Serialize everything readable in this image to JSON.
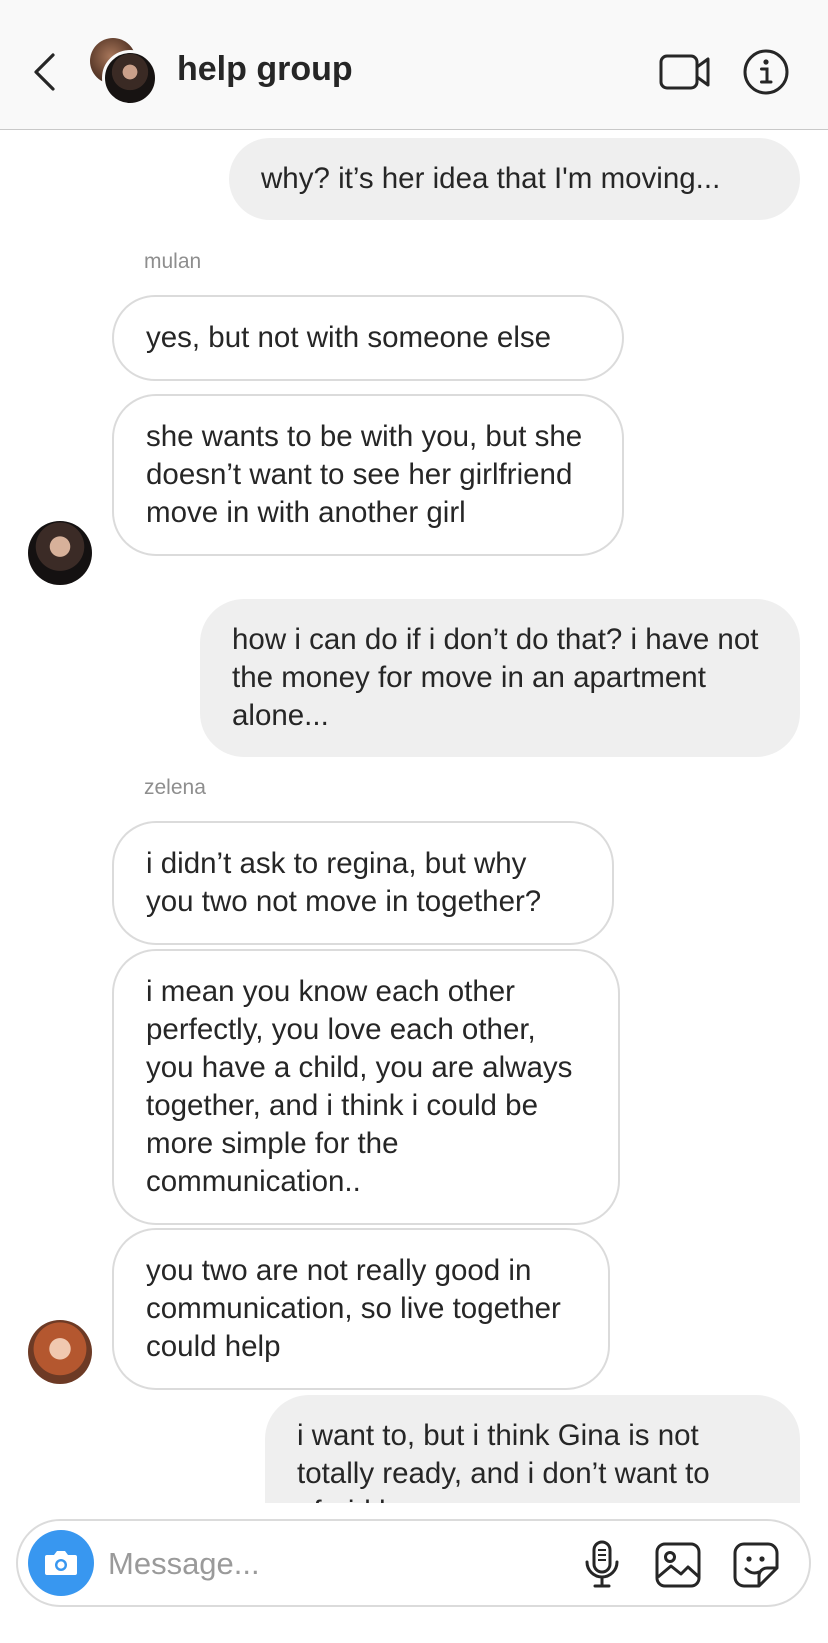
{
  "header": {
    "title": "help group",
    "icons": {
      "back": "chevron-left-icon",
      "video": "video-camera-icon",
      "info": "info-icon"
    }
  },
  "messages": [
    {
      "from": "me",
      "text": "why? it’s her idea that I'm moving..."
    },
    {
      "sender": "mulan"
    },
    {
      "from": "mulan",
      "text": "yes, but not with someone else"
    },
    {
      "from": "mulan",
      "text": "she wants to be with you, but she doesn’t want to see her girlfriend move in with another girl"
    },
    {
      "from": "me",
      "text": "how i can do if i don’t do that? i have not the money for move in an apartment alone..."
    },
    {
      "sender": "zelena"
    },
    {
      "from": "zelena",
      "text": "i didn’t ask to regina, but why you two not move in together?"
    },
    {
      "from": "zelena",
      "text": "i mean you know each other perfectly, you love each other, you have a child, you are always together, and i think i could be more simple for the communication.."
    },
    {
      "from": "zelena",
      "text": "you two are not really good in communication, so live together could help"
    },
    {
      "from": "me",
      "text": "i want to, but i think Gina is not totally ready, and i don’t want to afraid her or..."
    }
  ],
  "composer": {
    "placeholder": "Message...",
    "value": "",
    "icons": [
      "camera-icon",
      "microphone-icon",
      "image-icon",
      "sticker-icon"
    ]
  },
  "colors": {
    "outgoing_bubble": "#efefef",
    "incoming_border": "#dbdbdb",
    "accent": "#3897f0",
    "text": "#262626",
    "muted": "#8e8e8e"
  }
}
